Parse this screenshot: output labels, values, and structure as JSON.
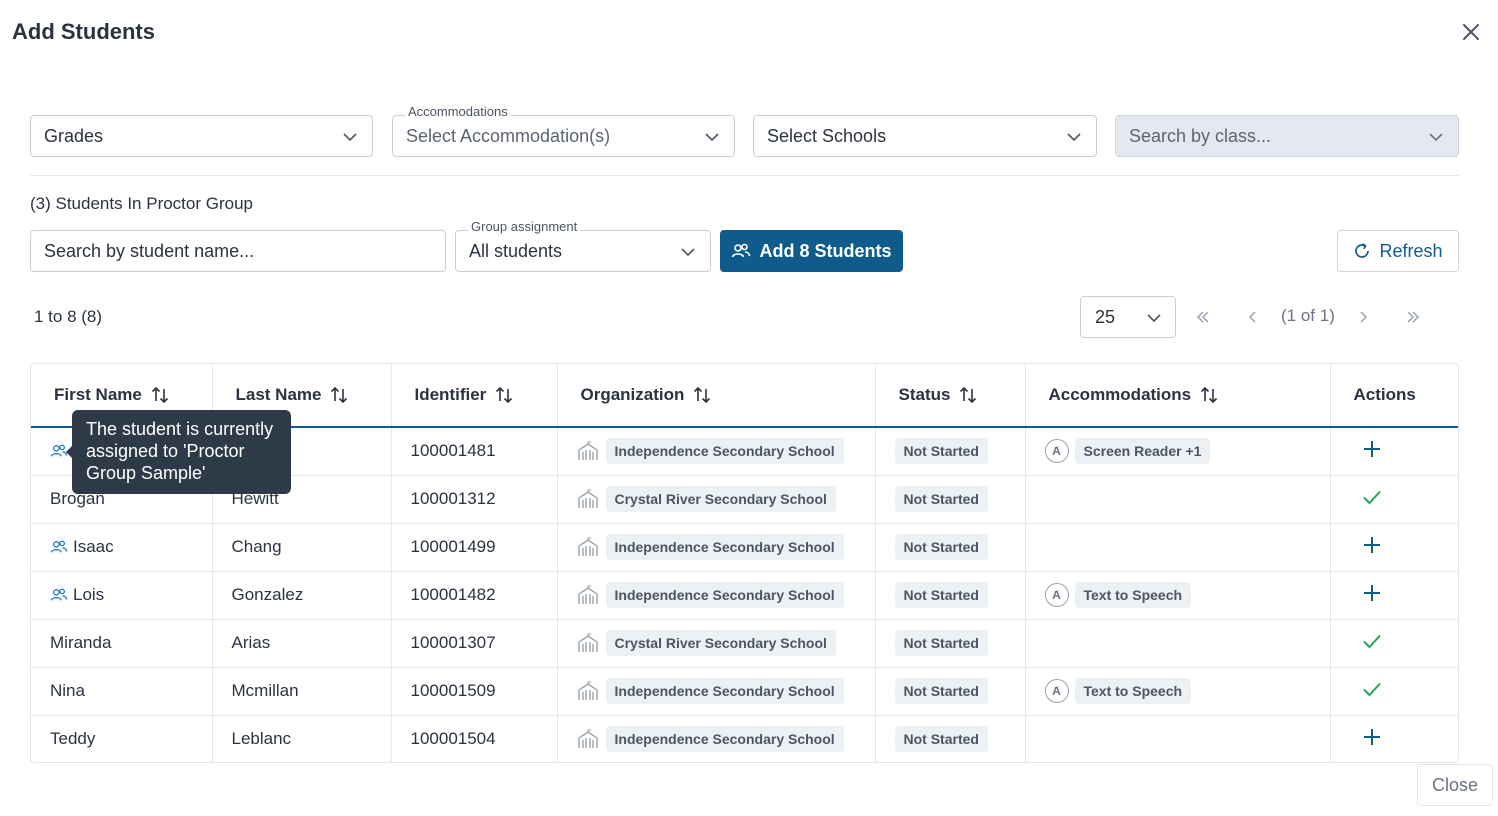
{
  "dialog": {
    "title": "Add Students"
  },
  "filters": {
    "grades": {
      "value": "Grades"
    },
    "accommodations": {
      "label": "Accommodations",
      "placeholder": "Select Accommodation(s)"
    },
    "schools": {
      "value": "Select Schools"
    },
    "class_search": {
      "placeholder": "Search by class..."
    }
  },
  "group": {
    "count_text": "(3) Students In Proctor Group",
    "search_placeholder": "Search by student name...",
    "assignment": {
      "label": "Group assignment",
      "value": "All students"
    },
    "add_button": "Add 8 Students",
    "refresh_button": "Refresh"
  },
  "pagination": {
    "range": "1 to 8 (8)",
    "page_size": "25",
    "page_text": "(1 of 1)",
    "first": "«",
    "prev": "‹",
    "next": "›",
    "last": "»"
  },
  "table": {
    "headers": [
      "First Name",
      "Last Name",
      "Identifier",
      "Organization",
      "Status",
      "Accommodations",
      "Actions"
    ],
    "rows": [
      {
        "first": "",
        "last": "",
        "id": "100001481",
        "org": "Independence Secondary School",
        "status": "Not Started",
        "acc": "Screen Reader +1",
        "acc_badge": "A",
        "in_group": true,
        "action": "plus"
      },
      {
        "first": "Brogan",
        "last": "Hewitt",
        "id": "100001312",
        "org": "Crystal River Secondary School",
        "status": "Not Started",
        "acc": "",
        "acc_badge": "",
        "in_group": false,
        "action": "check"
      },
      {
        "first": "Isaac",
        "last": "Chang",
        "id": "100001499",
        "org": "Independence Secondary School",
        "status": "Not Started",
        "acc": "",
        "acc_badge": "",
        "in_group": true,
        "action": "plus"
      },
      {
        "first": "Lois",
        "last": "Gonzalez",
        "id": "100001482",
        "org": "Independence Secondary School",
        "status": "Not Started",
        "acc": "Text to Speech",
        "acc_badge": "A",
        "in_group": true,
        "action": "plus"
      },
      {
        "first": "Miranda",
        "last": "Arias",
        "id": "100001307",
        "org": "Crystal River Secondary School",
        "status": "Not Started",
        "acc": "",
        "acc_badge": "",
        "in_group": false,
        "action": "check"
      },
      {
        "first": "Nina",
        "last": "Mcmillan",
        "id": "100001509",
        "org": "Independence Secondary School",
        "status": "Not Started",
        "acc": "Text to Speech",
        "acc_badge": "A",
        "in_group": false,
        "action": "check"
      },
      {
        "first": "Teddy",
        "last": "Leblanc",
        "id": "100001504",
        "org": "Independence Secondary School",
        "status": "Not Started",
        "acc": "",
        "acc_badge": "",
        "in_group": false,
        "action": "plus"
      }
    ]
  },
  "tooltip": {
    "text": "The student is currently assigned to 'Proctor Group Sample'"
  },
  "footer": {
    "close_button": "Close"
  },
  "colors": {
    "primary": "#0f5c8c",
    "group_icon": "#2f7fc1",
    "plus": "#0f5c8c",
    "check": "#22a559",
    "tooltip_bg": "#2e3a48"
  },
  "icons": {
    "close": "close-icon",
    "caret": "chevron-down-icon",
    "group": "group-icon",
    "refresh": "refresh-icon",
    "sort": "sort-icon",
    "school": "school-icon",
    "add": "plus-icon",
    "assigned": "check-icon"
  }
}
